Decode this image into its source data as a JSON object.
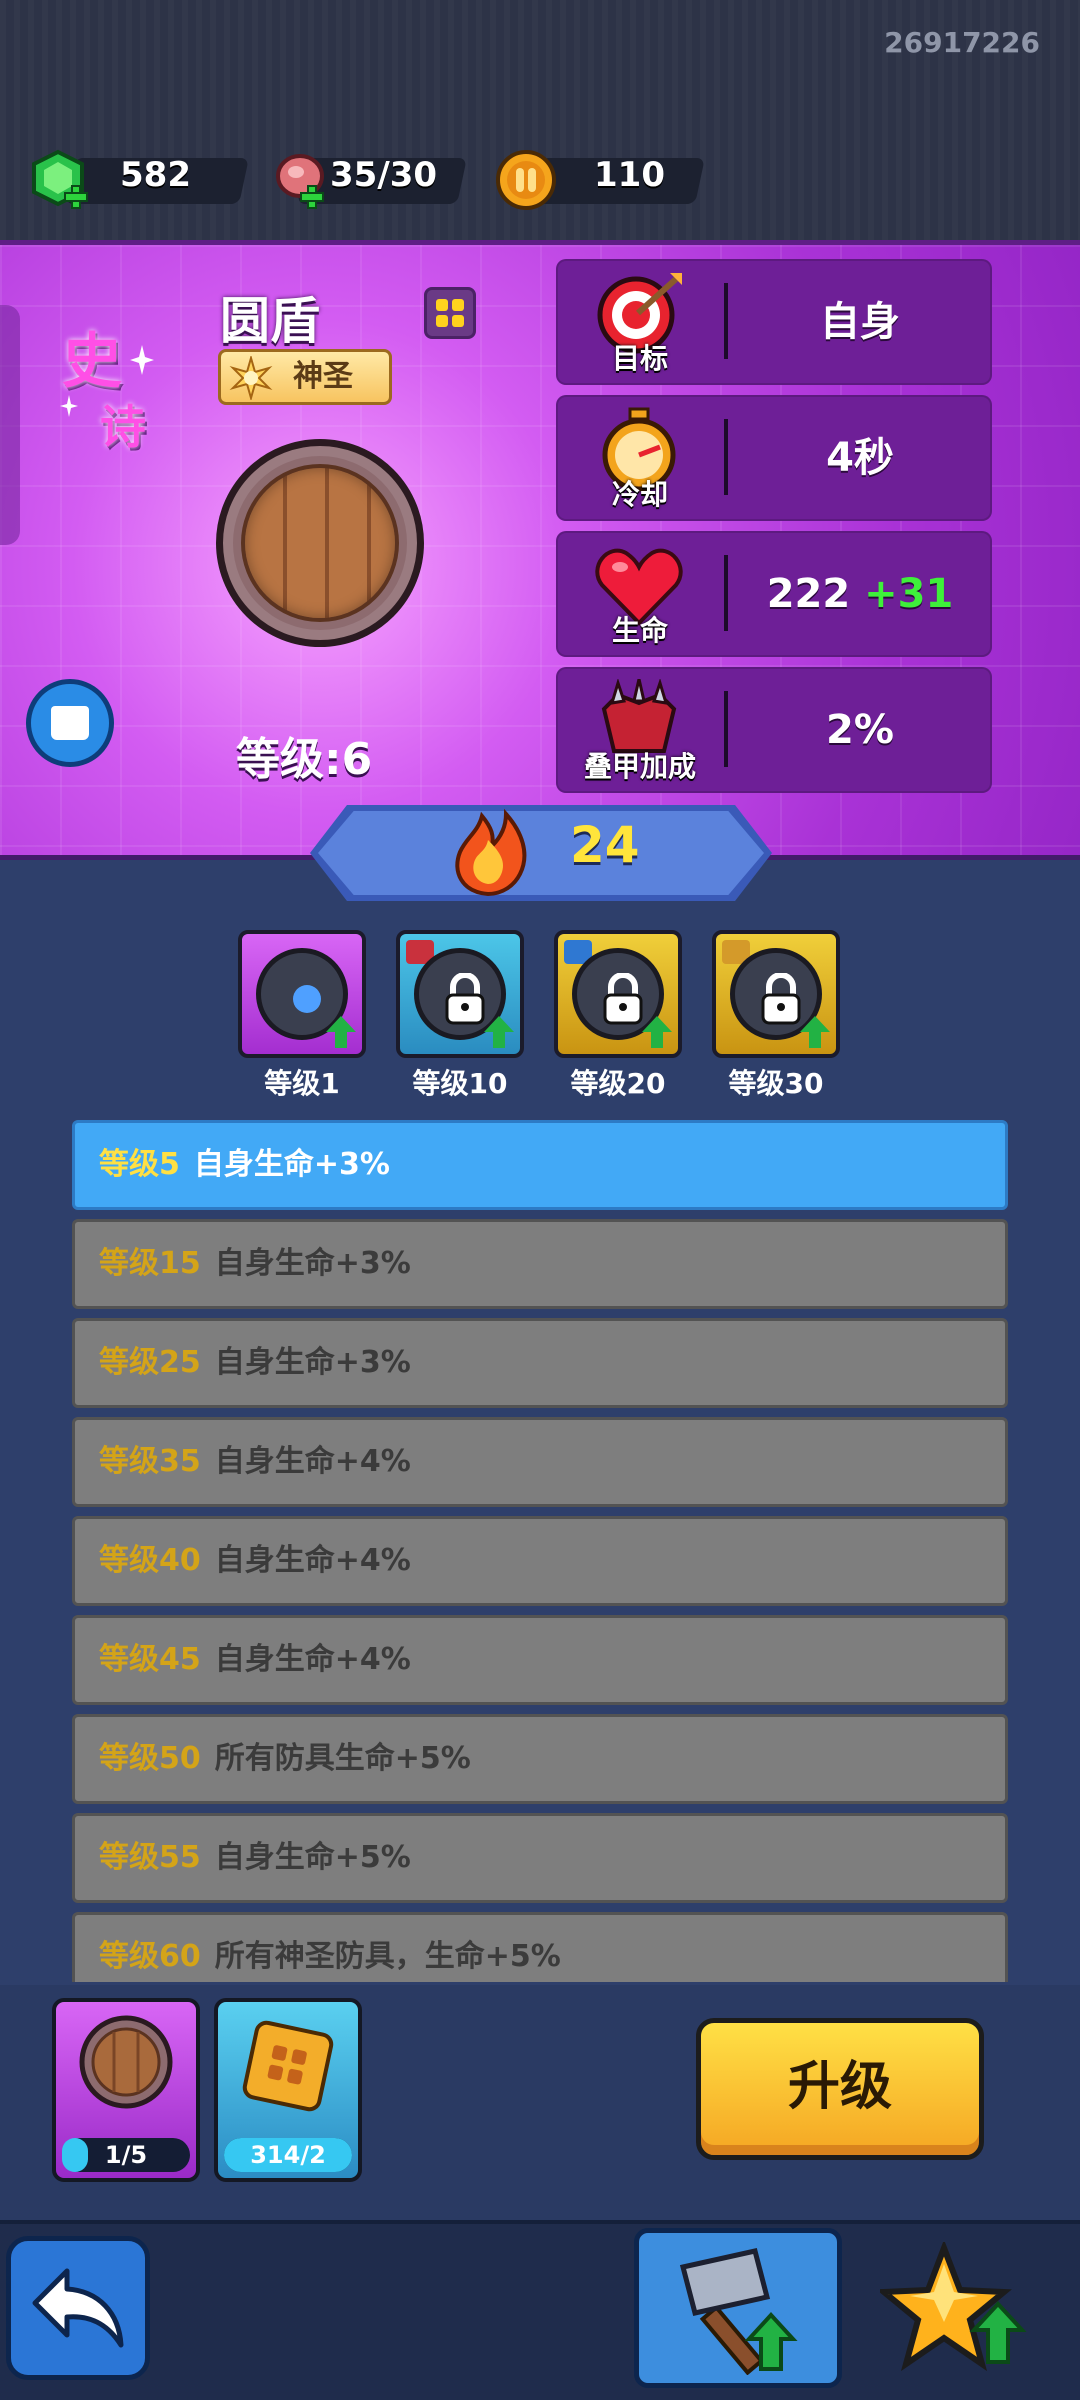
{
  "header": {
    "user_id": "26917226",
    "gems": "582",
    "meat": "35/30",
    "coins": "110"
  },
  "item": {
    "rarity_line1": "史",
    "rarity_line2": "诗",
    "name": "圆盾",
    "quality": "神圣",
    "level_text": "等级:6"
  },
  "stats": [
    {
      "label": "目标",
      "value": "自身",
      "icon": "target-icon"
    },
    {
      "label": "冷却",
      "value": "4秒",
      "icon": "stopwatch-icon"
    },
    {
      "label": "生命",
      "value": "222",
      "bonus": "+31",
      "icon": "heart-icon"
    },
    {
      "label": "叠甲加成",
      "value": "2%",
      "icon": "armor-icon"
    }
  ],
  "power": "24",
  "slots": [
    {
      "label": "等级1",
      "locked": false,
      "color": "#c247e8"
    },
    {
      "label": "等级10",
      "locked": true,
      "color": "#3ab0d8"
    },
    {
      "label": "等级20",
      "locked": true,
      "color": "#e2b21f"
    },
    {
      "label": "等级30",
      "locked": true,
      "color": "#e2b21f"
    }
  ],
  "bonuses": [
    {
      "level": "等级5",
      "text": "自身生命+3%",
      "active": true
    },
    {
      "level": "等级15",
      "text": "自身生命+3%",
      "active": false
    },
    {
      "level": "等级25",
      "text": "自身生命+3%",
      "active": false
    },
    {
      "level": "等级35",
      "text": "自身生命+4%",
      "active": false
    },
    {
      "level": "等级40",
      "text": "自身生命+4%",
      "active": false
    },
    {
      "level": "等级45",
      "text": "自身生命+4%",
      "active": false
    },
    {
      "level": "等级50",
      "text": "所有防具生命+5%",
      "active": false
    },
    {
      "level": "等级55",
      "text": "自身生命+5%",
      "active": false
    },
    {
      "level": "等级60",
      "text": "所有神圣防具，生命+5%",
      "active": false
    }
  ],
  "materials": [
    {
      "count": "1/5",
      "fill": 0.2
    },
    {
      "count": "314/2",
      "fill": 1.0
    }
  ],
  "upgrade_label": "升级",
  "colors": {
    "epic_purple": "#a932d6",
    "active_row": "#42a9f6",
    "upgrade_yellow": "#f5a623",
    "bonus_green": "#3ef03a",
    "power_yellow": "#ffe53b"
  }
}
